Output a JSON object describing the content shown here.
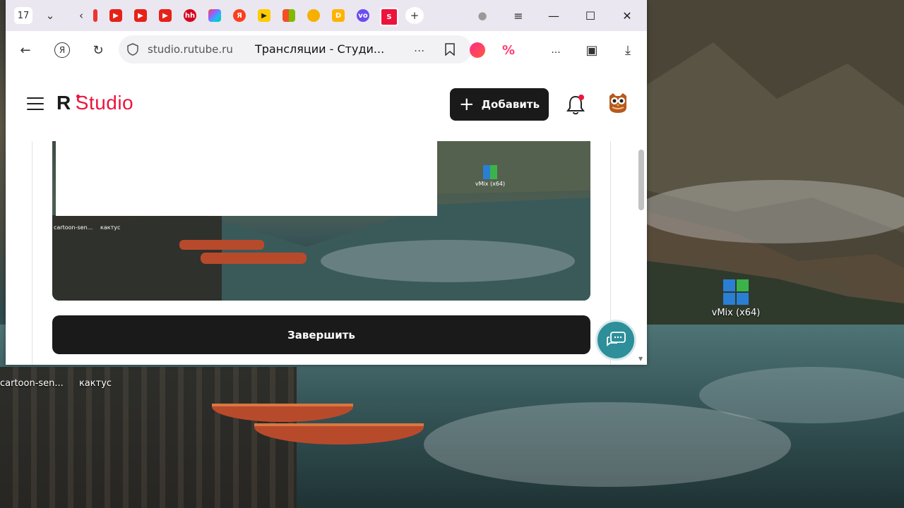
{
  "desktop": {
    "icons": [
      {
        "label": "vMix (x64)"
      },
      {
        "label": "cartoon-sen..."
      },
      {
        "label": "кактус"
      }
    ]
  },
  "browser": {
    "tab_count": "17",
    "url": "studio.rutube.ru",
    "page_title": "Трансляции - Студи...",
    "address_more": "...",
    "toolbar_more": "..."
  },
  "studio": {
    "logo_letter": "R",
    "logo_text": "Studio",
    "add_button": "Добавить",
    "finish_button": "Завершить",
    "preview_icon_label": "vMix (x64)",
    "preview_small_labels": [
      "cartoon-sen...",
      "кактус"
    ]
  },
  "colors": {
    "brand_red": "#ed143b",
    "dark_button": "#1a1a1a",
    "chat_teal": "#2c8f9a",
    "tabstrip_bg": "#ebe7f0"
  }
}
